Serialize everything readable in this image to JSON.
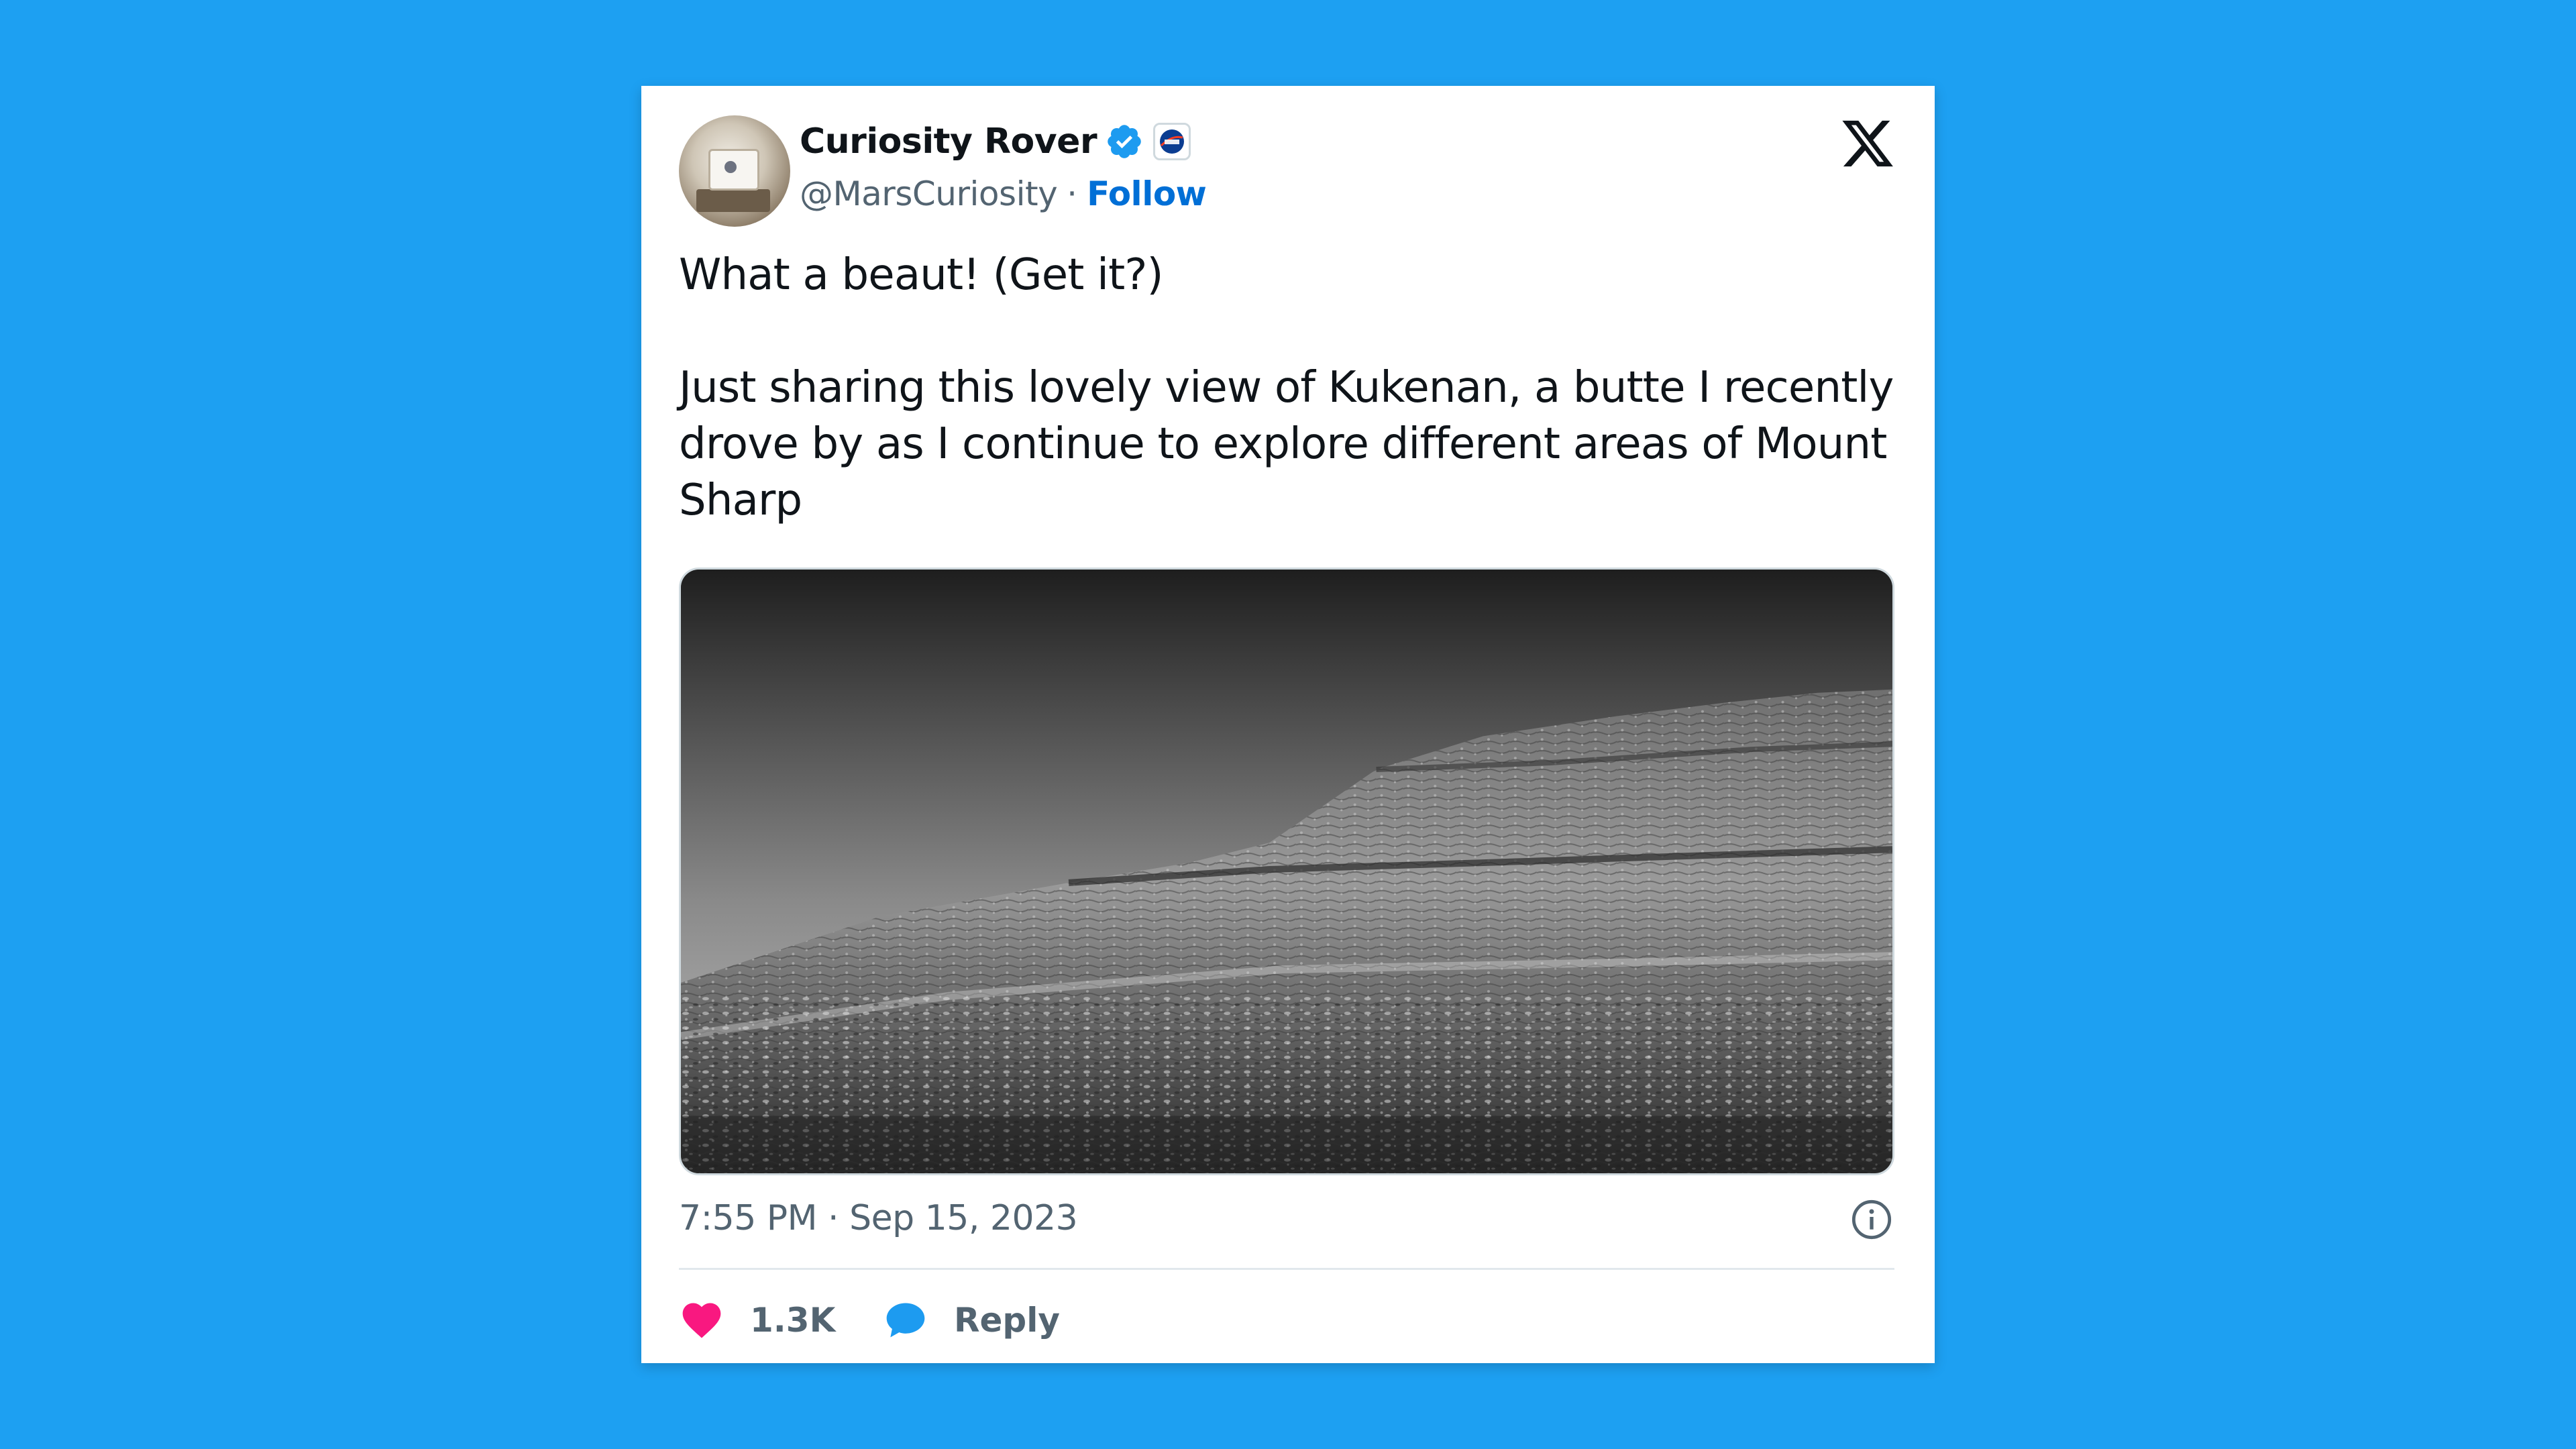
{
  "author": {
    "name": "Curiosity Rover",
    "handle": "@MarsCuriosity",
    "separator": "·",
    "follow_label": "Follow",
    "verified_icon": "verified-badge-icon",
    "affiliate_badge": "nasa-logo",
    "avatar": "rover-avatar"
  },
  "platform_logo": "x-logo",
  "tweet": {
    "line1": "What a beaut! (Get it?)",
    "line2": "Just sharing this lovely view of Kukenan, a butte I recently drove by as I continue to explore different areas of Mount Sharp",
    "media": "grayscale photo of a layered butte on Mars"
  },
  "meta": {
    "timestamp": "7:55 PM · Sep 15, 2023",
    "info_icon": "info-icon"
  },
  "actions": {
    "like_count": "1.3K",
    "reply_label": "Reply"
  },
  "colors": {
    "background": "#1da0f2",
    "card": "#ffffff",
    "link": "#006fd6",
    "heart": "#f91880",
    "reply": "#1d9bf0",
    "verified": "#1d9bf0",
    "secondary_text": "#536471"
  }
}
